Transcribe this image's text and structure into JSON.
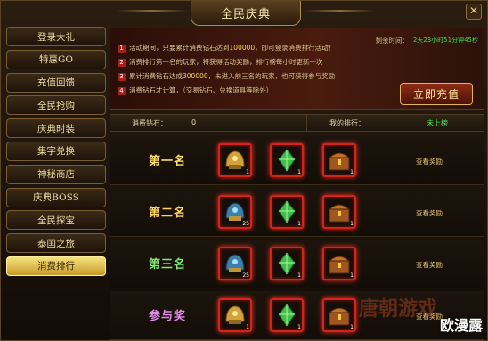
{
  "window": {
    "title": "全民庆典",
    "close": "✕"
  },
  "sidebar": {
    "items": [
      {
        "label": "登录大礼",
        "active": false
      },
      {
        "label": "特惠GO",
        "active": false
      },
      {
        "label": "充值回馈",
        "active": false
      },
      {
        "label": "全民抢购",
        "active": false
      },
      {
        "label": "庆典时装",
        "active": false
      },
      {
        "label": "集字兑换",
        "active": false
      },
      {
        "label": "神秘商店",
        "active": false
      },
      {
        "label": "庆典BOSS",
        "active": false
      },
      {
        "label": "全民探宝",
        "active": false
      },
      {
        "label": "泰国之旅",
        "active": false
      },
      {
        "label": "消费排行",
        "active": true
      }
    ]
  },
  "info": {
    "lines": [
      {
        "num": "1",
        "text": "活动期间，只要累计消费钻石达到",
        "highlight": "100000",
        "tail": "，即可登录消费排行活动！"
      },
      {
        "num": "2",
        "text": "消费排行第一名的玩家，将获得活动奖励，排行榜每小时更新一次",
        "highlight": "",
        "tail": ""
      },
      {
        "num": "3",
        "text": "累计消费钻石达成",
        "highlight": "300000",
        "tail": "，未进入前三名的玩家，也可获得参与奖励"
      },
      {
        "num": "4",
        "text": "消费钻石才计算，",
        "highlight": "",
        "tail": "（交易钻石、兑换道具等除外）"
      }
    ],
    "timer_label": "剩余时间：",
    "timer": "2天23小时51分钟45秒",
    "cta": "立即充值"
  },
  "stats": {
    "spent_label": "消费钻石：",
    "spent_value": "0",
    "rank_label": "我的排行：",
    "rank_value": "未上榜"
  },
  "ranks": [
    {
      "label": "第一名",
      "color": "#ffde6a",
      "reward_link": "查看奖励",
      "items": [
        {
          "icon": "golden-helmet-icon",
          "count": "1"
        },
        {
          "icon": "green-crystal-icon",
          "count": "1"
        },
        {
          "icon": "treasure-chest-icon",
          "count": "1"
        }
      ]
    },
    {
      "label": "第二名",
      "color": "#ffd25a",
      "reward_link": "查看奖励",
      "items": [
        {
          "icon": "blue-helmet-icon",
          "count": "25"
        },
        {
          "icon": "green-crystal-icon",
          "count": "1"
        },
        {
          "icon": "treasure-chest-icon",
          "count": "1"
        }
      ]
    },
    {
      "label": "第三名",
      "color": "#7be86f",
      "reward_link": "查看奖励",
      "items": [
        {
          "icon": "blue-helmet-icon",
          "count": "25"
        },
        {
          "icon": "green-crystal-icon",
          "count": "1"
        },
        {
          "icon": "treasure-chest-icon",
          "count": "1"
        }
      ]
    },
    {
      "label": "参与奖",
      "color": "#e08ae6",
      "reward_link": "查看奖励",
      "items": [
        {
          "icon": "golden-helmet-icon",
          "count": "1"
        },
        {
          "icon": "green-crystal-icon",
          "count": "1"
        },
        {
          "icon": "treasure-chest-icon",
          "count": "1"
        }
      ]
    }
  ],
  "watermark": {
    "site": "欧漫露",
    "logo": "唐朝游戏"
  },
  "colors": {
    "accent_gold": "#e7b35a",
    "slot_border": "#d2241c",
    "rank_value_green": "#49e04e"
  }
}
